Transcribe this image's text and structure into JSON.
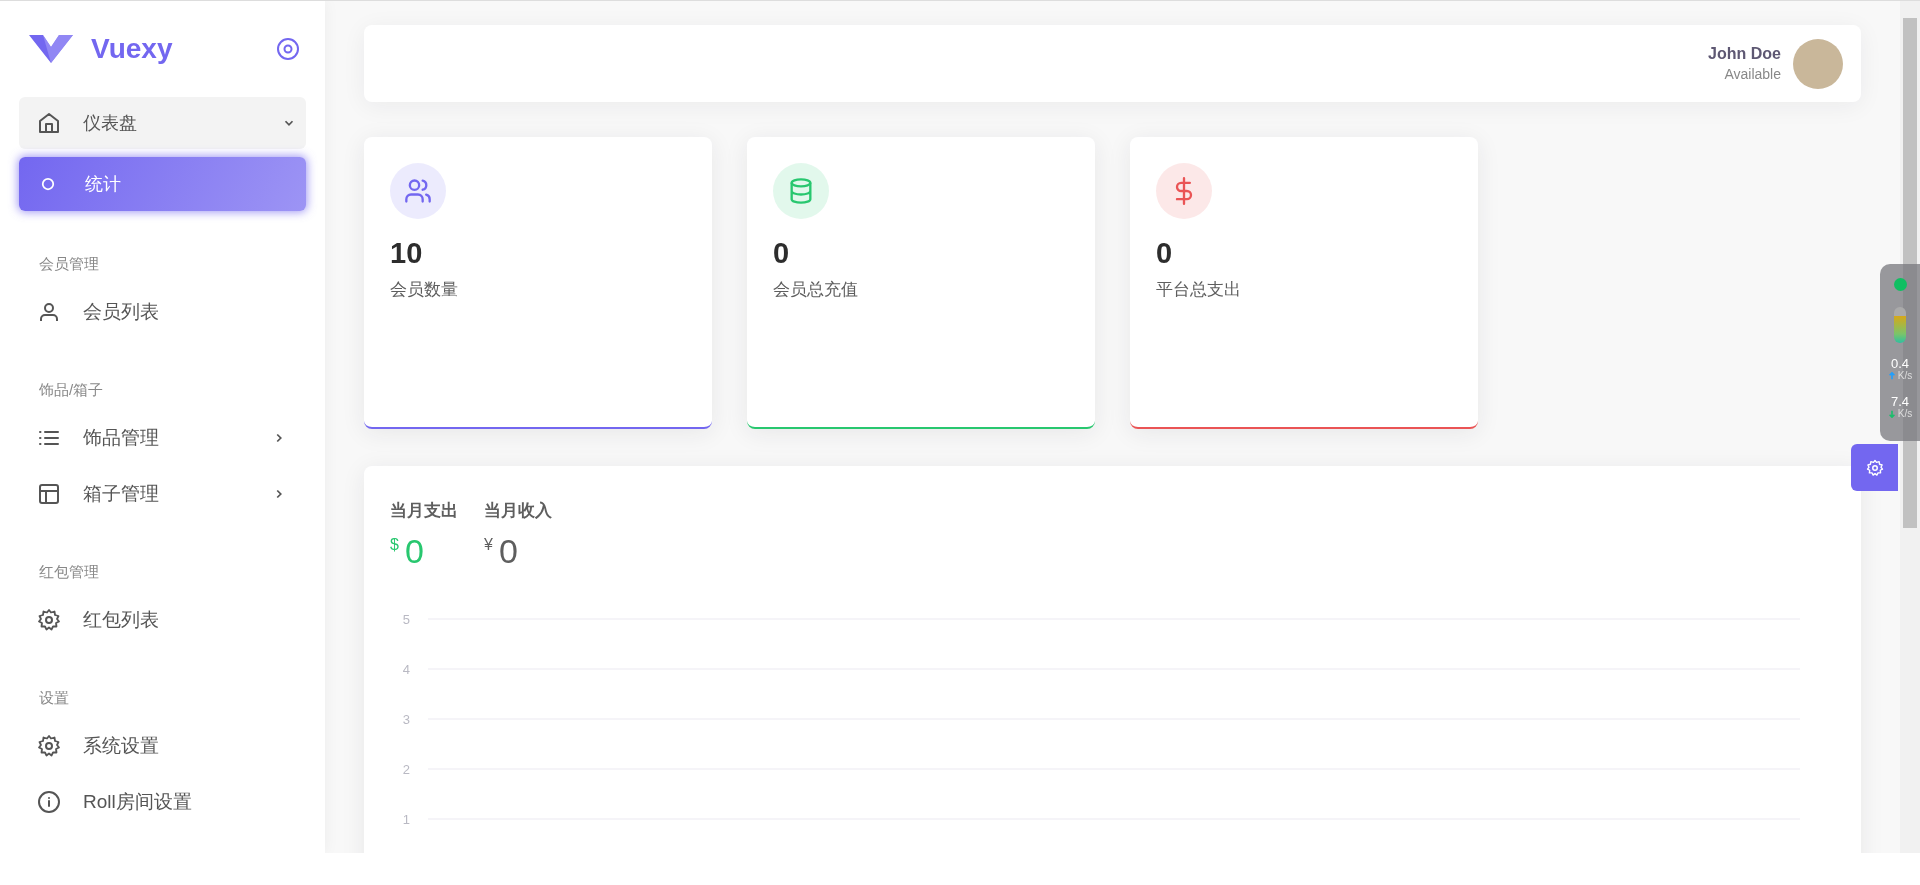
{
  "sidebar": {
    "logo": "Vuexy",
    "items": [
      {
        "kind": "group",
        "label": "仪表盘",
        "expanded": true,
        "children": [
          {
            "label": "统计",
            "selected": true
          }
        ]
      },
      {
        "kind": "heading",
        "label": "会员管理"
      },
      {
        "kind": "link",
        "label": "会员列表",
        "selected": false
      },
      {
        "kind": "heading",
        "label": "饰品/箱子"
      },
      {
        "kind": "submenu",
        "label": "饰品管理",
        "selected": false
      },
      {
        "kind": "submenu",
        "label": "箱子管理",
        "selected": false
      },
      {
        "kind": "heading",
        "label": "红包管理"
      },
      {
        "kind": "link",
        "label": "红包列表",
        "selected": false
      },
      {
        "kind": "heading",
        "label": "设置"
      },
      {
        "kind": "link",
        "label": "系统设置",
        "selected": false
      },
      {
        "kind": "link",
        "label": "Roll房间设置",
        "selected": false
      }
    ]
  },
  "header": {
    "user_name": "John Doe",
    "user_status": "Available"
  },
  "stats": [
    {
      "value": "10",
      "label": "会员数量",
      "color": "#7367f0"
    },
    {
      "value": "0",
      "label": "会员总充值",
      "color": "#28c76f"
    },
    {
      "value": "0",
      "label": "平台总支出",
      "color": "#ea5455"
    }
  ],
  "revenue": {
    "summary": [
      {
        "label": "当月支出",
        "currency": "$",
        "value": "0",
        "color": "#28c76f"
      },
      {
        "label": "当月收入",
        "currency": "¥",
        "value": "0",
        "color": "#5e5e5e"
      }
    ],
    "y_axis_labels": [
      "5",
      "4",
      "3",
      "2",
      "1"
    ]
  },
  "speed_widget": {
    "upload": "0.4",
    "upload_unit": "K/s",
    "download": "7.4",
    "download_unit": "K/s"
  }
}
